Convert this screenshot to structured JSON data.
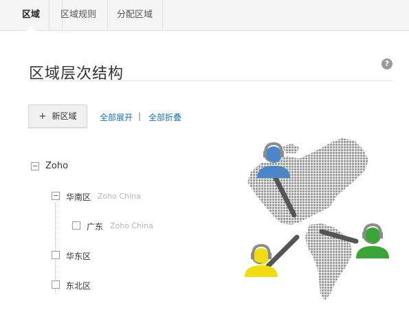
{
  "tabs": [
    {
      "label": "区域",
      "active": true
    },
    {
      "label": "区域规则",
      "active": false
    },
    {
      "label": "分配区域",
      "active": false
    }
  ],
  "page": {
    "title": "区域层次结构",
    "help_icon": "?"
  },
  "toolbar": {
    "new_button_icon": "+",
    "new_button_label": "新区域",
    "expand_all": "全部展开",
    "separator": "|",
    "collapse_all": "全部折叠"
  },
  "tree": {
    "root": {
      "label": "Zoho",
      "expanded": true
    },
    "south": {
      "label": "华南区",
      "owner": "Zoho China",
      "expanded": true
    },
    "guangdong": {
      "label": "广东",
      "owner": "Zoho China"
    },
    "east": {
      "label": "华东区"
    },
    "northeast": {
      "label": "东北区"
    }
  },
  "illustration": {
    "icons": [
      "agent-blue-icon",
      "agent-yellow-icon",
      "agent-green-icon",
      "americas-map-icon"
    ],
    "colors": {
      "blue": "#4a86c8",
      "yellow": "#f0dc10",
      "green": "#3aa536",
      "headset": "#8c8c8c",
      "map": "#9a9a9a",
      "link": "#555555"
    }
  }
}
